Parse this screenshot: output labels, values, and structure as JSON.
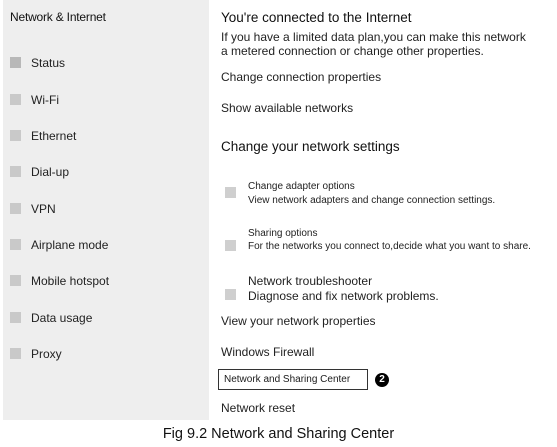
{
  "sidebar": {
    "title": "Network & Internet",
    "items": [
      {
        "label": "Status"
      },
      {
        "label": "Wi-Fi"
      },
      {
        "label": "Ethernet"
      },
      {
        "label": "Dial-up"
      },
      {
        "label": "VPN"
      },
      {
        "label": "Airplane mode"
      },
      {
        "label": "Mobile hotspot"
      },
      {
        "label": "Data usage"
      },
      {
        "label": "Proxy"
      }
    ]
  },
  "main": {
    "status_heading": "You're connected to the Internet",
    "status_desc_line1": "If you have a limited data plan,you can make this network",
    "status_desc_line2": "a metered connection or change other properties.",
    "change_connection_properties": "Change connection properties",
    "show_available_networks": "Show available networks",
    "settings_heading": "Change your network settings",
    "options": [
      {
        "title": "Change adapter options",
        "desc": "View network adapters and change connection settings."
      },
      {
        "title": "Sharing options",
        "desc": "For the networks you connect to,decide what you want to share."
      },
      {
        "title": "Network troubleshooter",
        "desc": "Diagnose and fix network problems."
      }
    ],
    "view_network_properties": "View your network properties",
    "windows_firewall": "Windows Firewall",
    "network_sharing_center": "Network and Sharing Center",
    "marker": "2",
    "network_reset": "Network reset"
  },
  "caption": "Fig 9.2 Network and Sharing Center"
}
